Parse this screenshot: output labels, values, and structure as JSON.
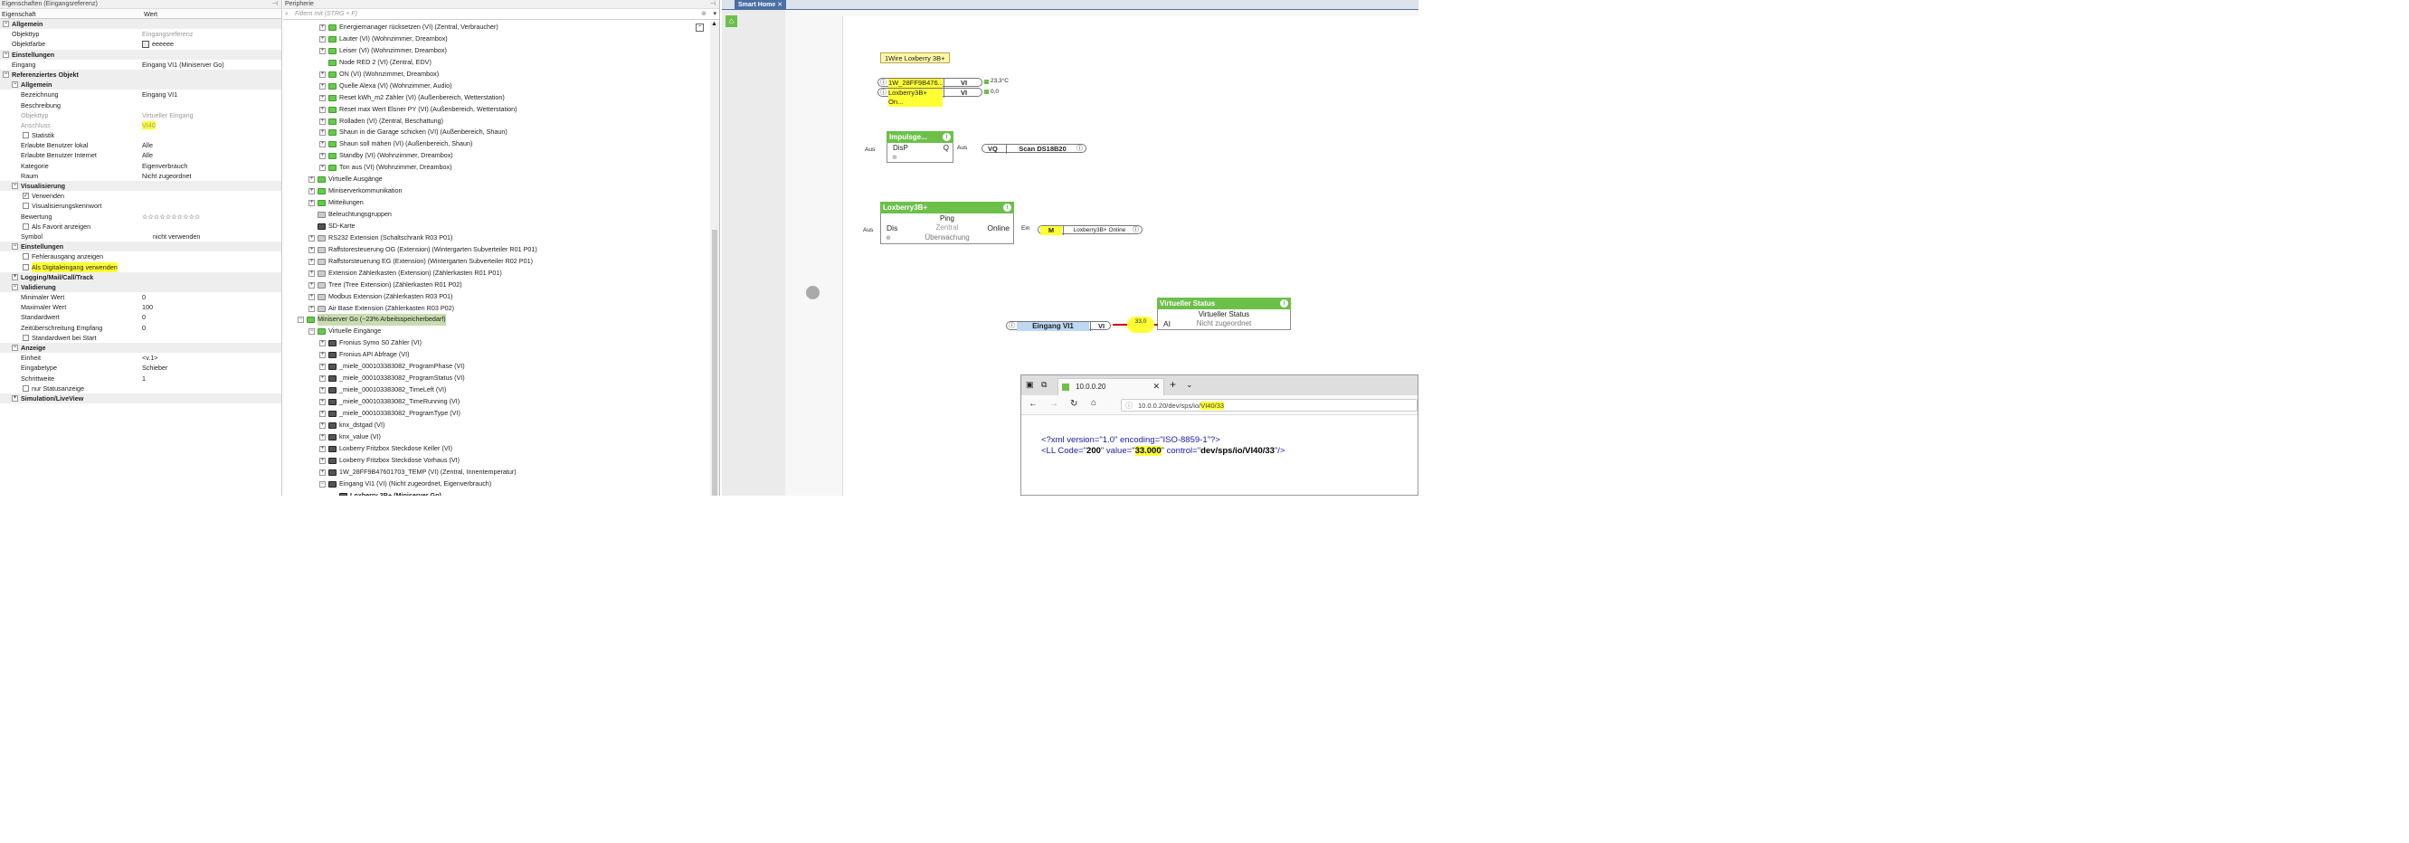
{
  "left_panel": {
    "title": "Eigenschaften (Eingangsreferenz)",
    "col_property": "Eigenschaft",
    "col_value": "Wert",
    "rows": [
      {
        "t": "s",
        "d": 0,
        "k": "Allgemein"
      },
      {
        "t": "r",
        "d": 1,
        "k": "Objekttyp",
        "v": "Eingangsreferenz",
        "g": 1
      },
      {
        "t": "r",
        "d": 1,
        "k": "Objektfarbe",
        "v": "eeeeee",
        "sw": 1
      },
      {
        "t": "s",
        "d": 0,
        "k": "Einstellungen"
      },
      {
        "t": "r",
        "d": 1,
        "k": "Eingang",
        "v": "Eingang VI1 (Miniserver Go)"
      },
      {
        "t": "s",
        "d": 0,
        "k": "Referenziertes Objekt"
      },
      {
        "t": "s",
        "d": 1,
        "k": "Allgemein"
      },
      {
        "t": "r",
        "d": 2,
        "k": "Bezeichnung",
        "v": "Eingang VI1"
      },
      {
        "t": "r",
        "d": 2,
        "k": "Beschreibung",
        "v": ""
      },
      {
        "t": "r",
        "d": 2,
        "k": "Objekttyp",
        "v": "Virtueller Eingang",
        "g": 1,
        "gk": 1
      },
      {
        "t": "r",
        "d": 2,
        "k": "Anschluss",
        "v": "VI40",
        "g": 1,
        "gk": 1,
        "hv": 1
      },
      {
        "t": "c",
        "d": 2,
        "k": "Statistik",
        "c": 0
      },
      {
        "t": "r",
        "d": 2,
        "k": "Erlaubte Benutzer lokal",
        "v": "Alle"
      },
      {
        "t": "r",
        "d": 2,
        "k": "Erlaubte Benutzer Internet",
        "v": "Alle"
      },
      {
        "t": "r",
        "d": 2,
        "k": "Kategorie",
        "v": "Eigenverbrauch"
      },
      {
        "t": "r",
        "d": 2,
        "k": "Raum",
        "v": "Nicht zugeordnet"
      },
      {
        "t": "s",
        "d": 1,
        "k": "Visualisierung"
      },
      {
        "t": "c",
        "d": 2,
        "k": "Verwenden",
        "c": 1
      },
      {
        "t": "c",
        "d": 2,
        "k": "Visualisierungskennwort",
        "c": 0
      },
      {
        "t": "r",
        "d": 2,
        "k": "Bewertung",
        "v": "☆☆☆☆☆☆☆☆☆☆"
      },
      {
        "t": "c",
        "d": 2,
        "k": "Als Favorit anzeigen",
        "c": 0
      },
      {
        "t": "r",
        "d": 2,
        "k": "Symbol",
        "v": "nicht verwenden",
        "vo": 12
      },
      {
        "t": "s",
        "d": 1,
        "k": "Einstellungen"
      },
      {
        "t": "c",
        "d": 2,
        "k": "Fehlerausgang anzeigen",
        "c": 0
      },
      {
        "t": "c",
        "d": 2,
        "k": "Als Digitaleingang verwenden",
        "c": 0,
        "h": 1
      },
      {
        "t": "s",
        "d": 1,
        "k": "Logging/Mail/Call/Track",
        "closed": 1
      },
      {
        "t": "s",
        "d": 1,
        "k": "Validierung"
      },
      {
        "t": "r",
        "d": 2,
        "k": "Minimaler Wert",
        "v": "0"
      },
      {
        "t": "r",
        "d": 2,
        "k": "Maximaler Wert",
        "v": "100"
      },
      {
        "t": "r",
        "d": 2,
        "k": "Standardwert",
        "v": "0"
      },
      {
        "t": "r",
        "d": 2,
        "k": "Zeitüberschreitung Empfang",
        "v": "0"
      },
      {
        "t": "c",
        "d": 2,
        "k": "Standardwert bei Start",
        "c": 0
      },
      {
        "t": "s",
        "d": 1,
        "k": "Anzeige"
      },
      {
        "t": "r",
        "d": 2,
        "k": "Einheit",
        "v": "<v.1>"
      },
      {
        "t": "r",
        "d": 2,
        "k": "Eingabetype",
        "v": "Schieber"
      },
      {
        "t": "r",
        "d": 2,
        "k": "Schrittweite",
        "v": "1"
      },
      {
        "t": "c",
        "d": 2,
        "k": "nur Statusanzeige",
        "c": 0
      },
      {
        "t": "s",
        "d": 1,
        "k": "Simulation/LiveView",
        "closed": 1
      }
    ]
  },
  "mid_panel": {
    "title": "Peripherie",
    "filter_placeholder": "Filtern mit (STRG + F)",
    "items": [
      {
        "d": 2,
        "i": "g",
        "t": "Energiemanager rücksetzen (VI) (Zentral, Verbraucher)",
        "x": 1
      },
      {
        "d": 2,
        "i": "g",
        "t": "Lauter (VI) (Wohnzimmer, Dreambox)",
        "x": 1
      },
      {
        "d": 2,
        "i": "g",
        "t": "Leiser (VI) (Wohnzimmer, Dreambox)",
        "x": 1
      },
      {
        "d": 2,
        "i": "g",
        "t": "Node RED 2 (VI) (Zentral, EDV)"
      },
      {
        "d": 2,
        "i": "g",
        "t": "ON (VI) (Wohnzimmer, Dreambox)",
        "x": 1
      },
      {
        "d": 2,
        "i": "g",
        "t": "Quelle Alexa (VI) (Wohnzimmer, Audio)",
        "x": 1
      },
      {
        "d": 2,
        "i": "g",
        "t": "Reset kWh_m2 Zähler (VI) (Außenbereich, Wetterstation)",
        "x": 1
      },
      {
        "d": 2,
        "i": "g",
        "t": "Reset max Wert Elsner PY (VI) (Außenbereich, Wetterstation)",
        "x": 1
      },
      {
        "d": 2,
        "i": "g",
        "t": "Rolladen (VI) (Zentral, Beschattung)",
        "x": 1
      },
      {
        "d": 2,
        "i": "g",
        "t": "Shaun in die Garage schicken (VI) (Außenbereich, Shaun)",
        "x": 1
      },
      {
        "d": 2,
        "i": "g",
        "t": "Shaun soll mähen (VI) (Außenbereich, Shaun)",
        "x": 1
      },
      {
        "d": 2,
        "i": "g",
        "t": "Standby (VI) (Wohnzimmer, Dreambox)",
        "x": 1
      },
      {
        "d": 2,
        "i": "g",
        "t": "Ton aus (VI) (Wohnzimmer, Dreambox)",
        "x": 1
      },
      {
        "d": 1,
        "i": "g",
        "t": "Virtuelle Ausgänge",
        "x": 1
      },
      {
        "d": 1,
        "i": "g",
        "t": "Miniserverkommunikation",
        "x": 1
      },
      {
        "d": 1,
        "i": "g",
        "t": "Mitteilungen",
        "x": 1
      },
      {
        "d": 1,
        "i": "y",
        "t": "Beleuchtungsgruppen"
      },
      {
        "d": 1,
        "i": "k",
        "t": "SD-Karte"
      },
      {
        "d": 1,
        "i": "s",
        "t": "RS232 Extension (Schaltschrank R03 P01)",
        "x": 1
      },
      {
        "d": 1,
        "i": "s",
        "t": "Raffstoresteuerung OG (Extension) (Wintergarten Subverteiler R01 P01)",
        "x": 1
      },
      {
        "d": 1,
        "i": "s",
        "t": "Raffstorsteuerung EG (Extension) (Wintergarten Subverteiler R02 P01)",
        "x": 1
      },
      {
        "d": 1,
        "i": "s",
        "t": "Extension Zählerkasten (Extension) (Zählerkasten R01 P01)",
        "x": 1
      },
      {
        "d": 1,
        "i": "s",
        "t": "Tree (Tree Extension) (Zählerkasten R01 P02)",
        "x": 1
      },
      {
        "d": 1,
        "i": "s",
        "t": "Modbus Extension (Zählerkasten R03 P01)",
        "x": 1
      },
      {
        "d": 1,
        "i": "s",
        "t": "Air Base Extension (Zählerkasten R03 P02)",
        "x": 1
      },
      {
        "d": 0,
        "i": "g",
        "t": "Miniserver Go (~23% Arbeitsspeicherbedarf)",
        "x": 2,
        "hl": 1
      },
      {
        "d": 1,
        "i": "g",
        "t": "Virtuelle Eingänge",
        "x": 2
      },
      {
        "d": 2,
        "i": "k",
        "t": "Fronius Symo S0 Zähler (VI)",
        "x": 1
      },
      {
        "d": 2,
        "i": "k",
        "t": "Fronius API Abfrage (VI)",
        "x": 1
      },
      {
        "d": 2,
        "i": "k",
        "t": "_miele_000103383082_ProgramPhase (VI)",
        "x": 1
      },
      {
        "d": 2,
        "i": "k",
        "t": "_miele_000103383082_ProgramStatus (VI)",
        "x": 1
      },
      {
        "d": 2,
        "i": "k",
        "t": "_miele_000103383082_TimeLeft (VI)",
        "x": 1
      },
      {
        "d": 2,
        "i": "k",
        "t": "_miele_000103383082_TimeRunning (VI)",
        "x": 1
      },
      {
        "d": 2,
        "i": "k",
        "t": "_miele_000103383082_ProgramType (VI)",
        "x": 1
      },
      {
        "d": 2,
        "i": "k",
        "t": "knx_dstgad (VI)",
        "x": 1
      },
      {
        "d": 2,
        "i": "k",
        "t": "knx_value (VI)",
        "x": 1
      },
      {
        "d": 2,
        "i": "k",
        "t": "Loxberry Fritzbox Steckdose Keller (VI)",
        "x": 1
      },
      {
        "d": 2,
        "i": "k",
        "t": "Loxberry Fritzbox Steckdose Vorhaus (VI)",
        "x": 1
      },
      {
        "d": 2,
        "i": "k",
        "t": "1W_28FF9B47601703_TEMP (VI) (Zentral, Innentemperatur)",
        "x": 1
      },
      {
        "d": 2,
        "i": "k",
        "t": "Eingang VI1 (VI) (Nicht zugeordnet, Eigenverbrauch)",
        "x": 2
      },
      {
        "d": 3,
        "i": "k",
        "t": "Loxberry 3B+ (Miniserver Go)",
        "b": 1
      }
    ]
  },
  "canvas": {
    "tab_label": "Smart Home",
    "label_1wire": "1Wire Loxberry 3B+",
    "ref1_name": "1W_28FF9B476...",
    "ref1_type": "VI",
    "ref1_value": "23,3°C",
    "ref2_name": "Loxberry3B+ On...",
    "ref2_type": "VI",
    "ref2_value": "0,0",
    "impulse_title": "Impulsge...",
    "impulse_in_label": "Aus",
    "impulse_dis": "DisP",
    "impulse_q": "Q",
    "impulse_out_label": "Aus",
    "vq_type": "VQ",
    "vq_name": "Scan DS18B20",
    "lox_title": "Loxberry3B+",
    "lox_ping": "Ping",
    "lox_dis": "Dis",
    "lox_zentral": "Zentral",
    "lox_online": "Online",
    "lox_uber": "Überwachung",
    "lox_in_label": "Aus",
    "lox_out_label": "Ein",
    "m_type": "M",
    "m_name": "Loxberry3B+ Online",
    "vs_title": "Virtueller Status",
    "vs_sub": "Virtueller Status",
    "vs_ai": "AI",
    "vs_room": "Nicht zugeordnet",
    "eingang_name": "Eingang VI1",
    "eingang_type": "VI",
    "wire_value": "33,0"
  },
  "browser": {
    "tab_title": "10.0.0.20",
    "url_prefix": "10.0.0.20/dev/sps/io/",
    "url_highlight": "VI40/33",
    "xml_line1": "<?xml version=\"1.0\" encoding=\"ISO-8859-1\"?>",
    "xml2_a": "<LL Code=\"",
    "xml2_code": "200",
    "xml2_b": "\" value=\"",
    "xml2_value": "33.000",
    "xml2_c": "\" control=\"",
    "xml2_control": "dev/sps/io/VI40/33",
    "xml2_d": "\"/>"
  }
}
